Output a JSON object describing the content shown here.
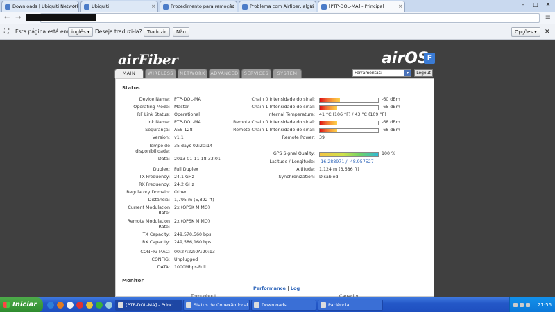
{
  "browser": {
    "tabs": [
      {
        "label": "Downloads | Ubiquiti Network"
      },
      {
        "label": "Ubiquiti"
      },
      {
        "label": "Procedimento para remoção"
      },
      {
        "label": "Problema com Airfiber, algui"
      },
      {
        "label": "[PTP-DOL-MA] - Principal"
      }
    ],
    "window_buttons": {
      "minimize": "–",
      "maximize": "□",
      "close": "✕"
    },
    "translate_bar": {
      "prefix": "Esta página está em",
      "language": "inglês",
      "question": "Deseja traduzi-la?",
      "translate_button": "Traduzir",
      "no_button": "Não",
      "options_button": "Opções"
    }
  },
  "app": {
    "logo_left": "airFiber",
    "logo_right": "airOS",
    "logo_badge": "F",
    "tabs": [
      "MAIN",
      "WIRELESS",
      "NETWORK",
      "ADVANCED",
      "SERVICES",
      "SYSTEM"
    ],
    "active_tab": "MAIN",
    "tools_select": "Ferramentas:",
    "logout_button": "Logout"
  },
  "status": {
    "title": "Status",
    "left_fields": [
      {
        "label": "Device Name:",
        "value": "PTP-DOL-MA"
      },
      {
        "label": "Operating Mode:",
        "value": "Master"
      },
      {
        "label": "RF Link Status:",
        "value": "Operational"
      },
      {
        "label": "Link Name:",
        "value": "PTP-DOL-MA"
      },
      {
        "label": "Segurança:",
        "value": "AES-128"
      },
      {
        "label": "Version:",
        "value": "v1.1"
      },
      {
        "label": "Tempo de disponibilidade:",
        "value": "35 days 02:20:14"
      },
      {
        "label": "Data:",
        "value": "2013-01-11 18:33:01"
      },
      {
        "label": "Duplex:",
        "value": "Full Duplex"
      },
      {
        "label": "TX Frequency:",
        "value": "24.1 GHz"
      },
      {
        "label": "RX Frequency:",
        "value": "24.2 GHz"
      },
      {
        "label": "Regulatory Domain:",
        "value": "Other"
      },
      {
        "label": "Distância:",
        "value": "1,795 m (5,892 ft)"
      },
      {
        "label": "Current Modulation Rate:",
        "value": "2x (QPSK MIMO)"
      },
      {
        "label": "Remote Modulation Rate:",
        "value": "2x (QPSK MIMO)"
      },
      {
        "label": "TX Capacity:",
        "value": "249,570,560 bps"
      },
      {
        "label": "RX Capacity:",
        "value": "249,586,160 bps"
      },
      {
        "label": "CONFIG MAC:",
        "value": "00:27:22:0A:20:13"
      },
      {
        "label": "CONFIG:",
        "value": "Unplugged"
      },
      {
        "label": "DATA:",
        "value": "1000Mbps-Full"
      }
    ],
    "right_fields": [
      {
        "label": "Chain 0 Intensidade do sinal:",
        "value": "-60 dBm",
        "level": 0.35
      },
      {
        "label": "Chain 1 Intensidade do sinal:",
        "value": "-65 dBm",
        "level": 0.3
      },
      {
        "label": "Internal Temperature:",
        "value": "41 °C (106 °F) / 43 °C (109 °F)"
      },
      {
        "label": "Remote Chain 0 Intensidade do sinal:",
        "value": "-68 dBm",
        "level": 0.3
      },
      {
        "label": "Remote Chain 1 Intensidade do sinal:",
        "value": "-68 dBm",
        "level": 0.3
      },
      {
        "label": "Remote Power:",
        "value": "39"
      },
      {
        "label": "GPS Signal Quality:",
        "value": "100 %",
        "level": 1.0
      },
      {
        "label": "Latitude / Longitude:",
        "value": "-16.288971 / -48.957527"
      },
      {
        "label": "Altitude:",
        "value": "1,124 m (3,686 ft)"
      },
      {
        "label": "Synchronization:",
        "value": "Disabled"
      }
    ]
  },
  "monitor": {
    "title": "Monitor",
    "performance_link": "Performance",
    "separator": "|",
    "log_link": "Log",
    "throughput_label": "Throughput",
    "capacity_label": "Capacity"
  },
  "taskbar": {
    "start": "Iniciar",
    "tasks": [
      {
        "label": "[PTP-DOL-MA] - Princi..."
      },
      {
        "label": "Status de Conexão local"
      },
      {
        "label": "Downloads"
      },
      {
        "label": "Paciência"
      }
    ],
    "clock": "21:56"
  }
}
